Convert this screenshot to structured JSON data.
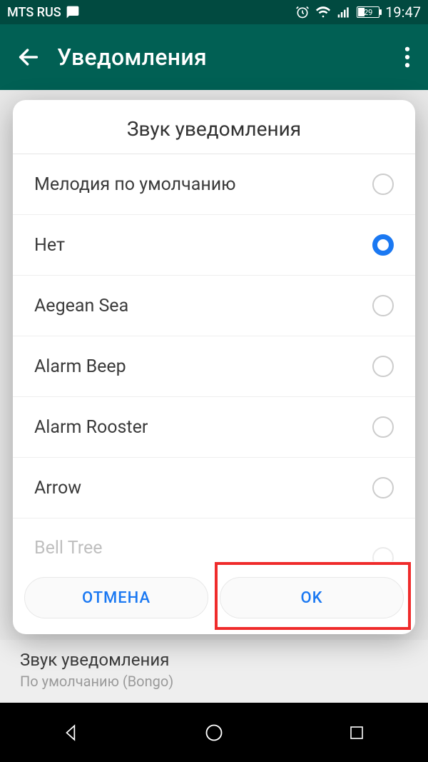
{
  "statusbar": {
    "carrier": "MTS RUS",
    "battery_pct": "29",
    "time": "19:47"
  },
  "appbar": {
    "title": "Уведомления"
  },
  "dialog": {
    "title": "Звук уведомления",
    "options": [
      {
        "label": "Мелодия по умолчанию",
        "selected": false
      },
      {
        "label": "Нет",
        "selected": true
      },
      {
        "label": "Aegean Sea",
        "selected": false
      },
      {
        "label": "Alarm Beep",
        "selected": false
      },
      {
        "label": "Alarm Rooster",
        "selected": false
      },
      {
        "label": "Arrow",
        "selected": false
      },
      {
        "label": "Bell Tree",
        "selected": false
      }
    ],
    "cancel_label": "ОТМЕНА",
    "ok_label": "OK"
  },
  "background_row": {
    "title": "Звук уведомления",
    "subtitle": "По умолчанию (Bongo)"
  }
}
